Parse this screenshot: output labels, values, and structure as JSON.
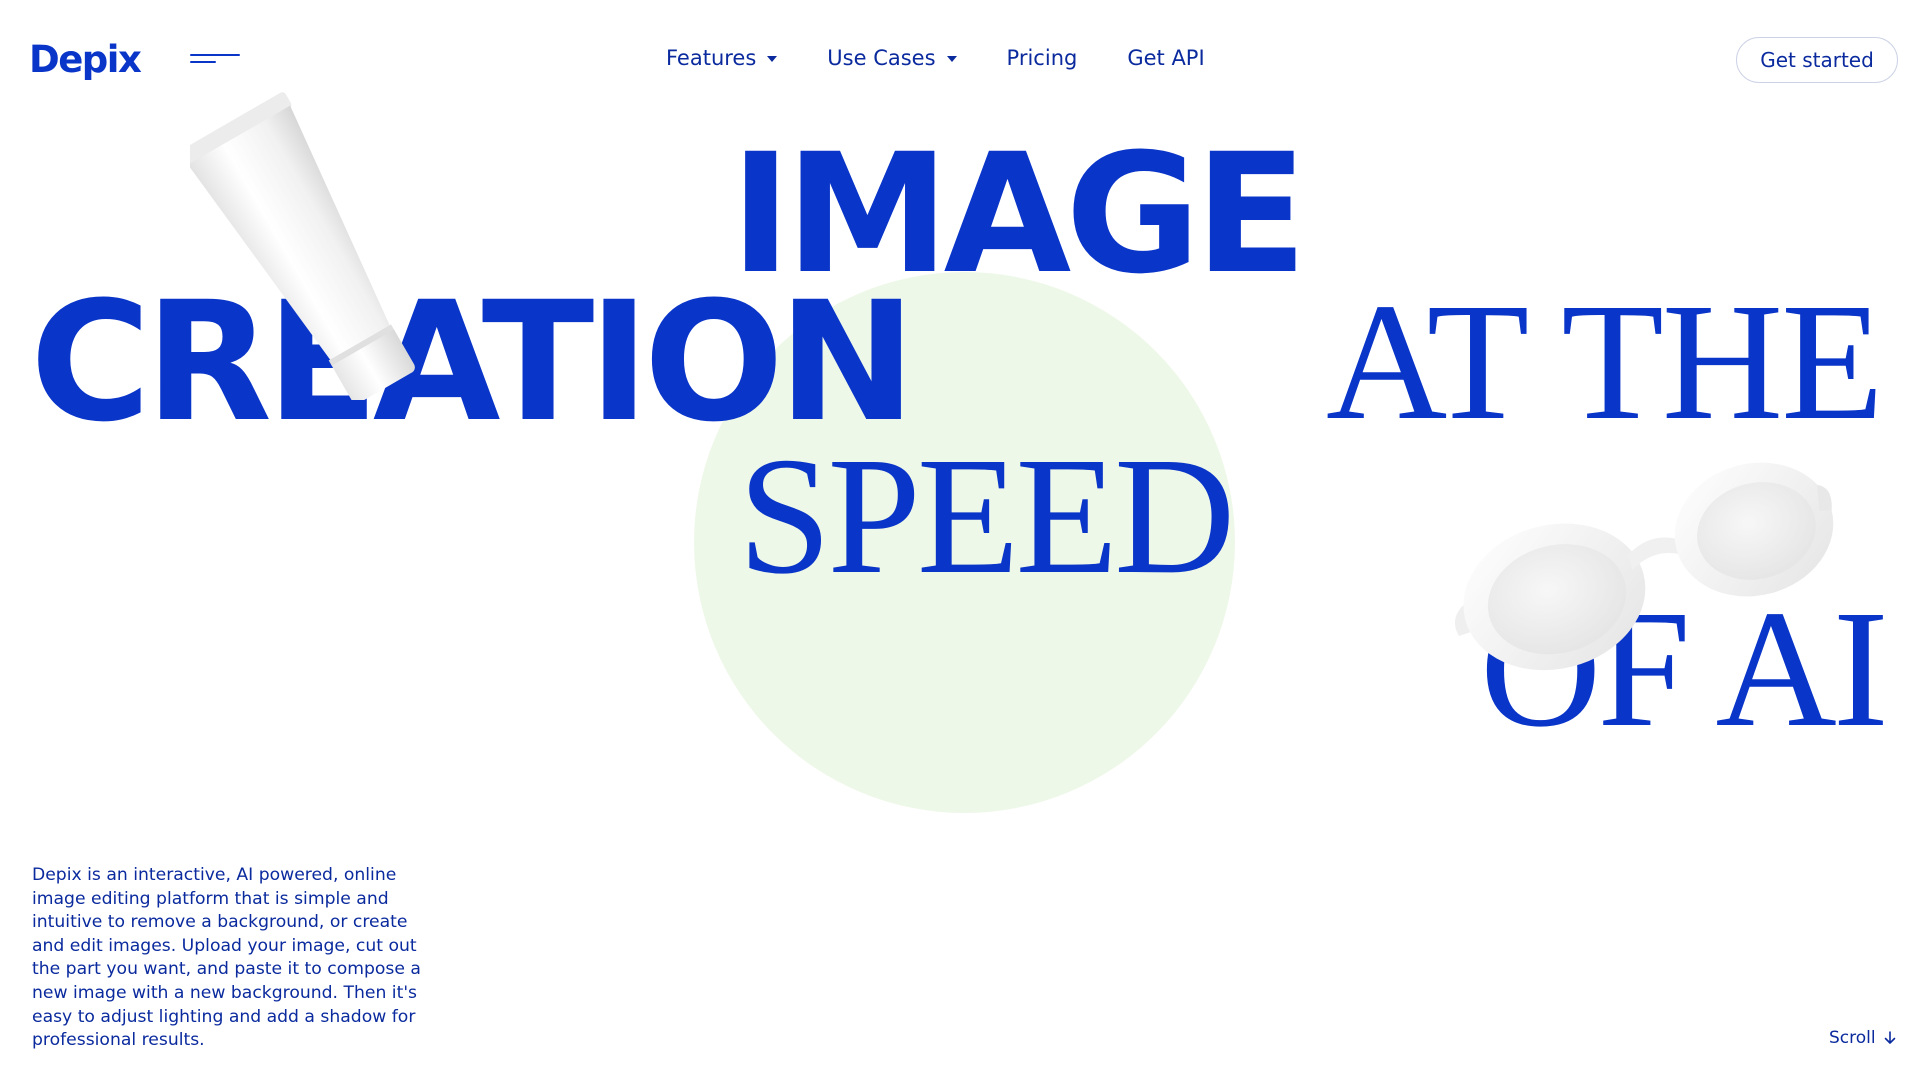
{
  "header": {
    "logo": "Depix",
    "nav": [
      {
        "label": "Features",
        "has_dropdown": true
      },
      {
        "label": "Use Cases",
        "has_dropdown": true
      },
      {
        "label": "Pricing",
        "has_dropdown": false
      },
      {
        "label": "Get API",
        "has_dropdown": false
      }
    ],
    "cta_label": "Get started",
    "menu_icon": "hamburger-menu-icon"
  },
  "hero": {
    "line1": "IMAGE",
    "line2": "CREATION",
    "line3": "AT THE",
    "line4": "SPEED",
    "line5": "OF AI",
    "images": [
      "cosmetic-tube",
      "sunglasses"
    ]
  },
  "description": "Depix is an interactive, AI powered, online image editing platform that is simple and intuitive to remove a background, or create and edit images. Upload your image, cut out the part you want, and paste it to compose a new image with a new background. Then it's easy to adjust lighting and add a shadow for professional results.",
  "scroll": {
    "label": "Scroll",
    "icon": "arrow-down-icon"
  },
  "colors": {
    "brand_blue": "#0a35c9",
    "text_blue": "#0a2a9e",
    "circle_green": "#eef8e8",
    "background": "#ffffff"
  }
}
